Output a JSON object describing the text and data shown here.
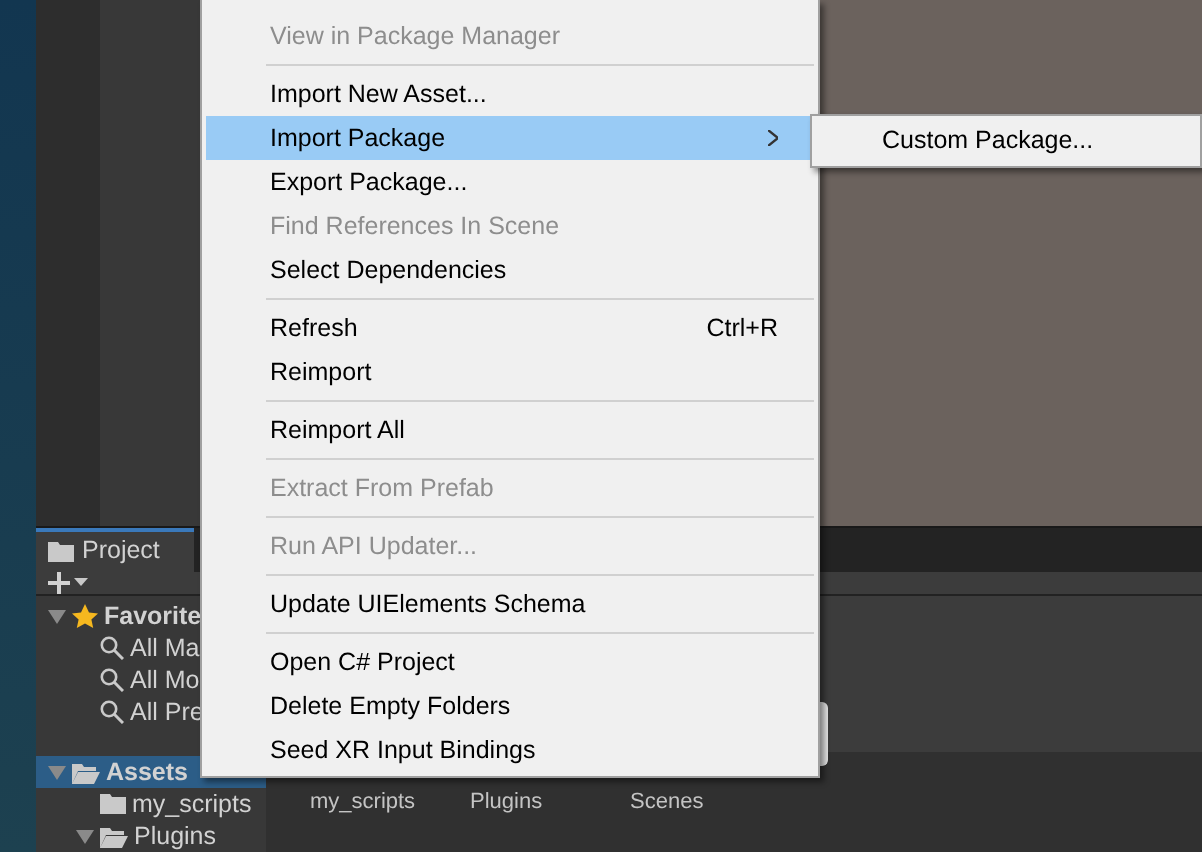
{
  "menu": {
    "items": [
      {
        "kind": "item",
        "label": "View in Package Manager",
        "disabled": true,
        "selected": false
      },
      {
        "kind": "separator"
      },
      {
        "kind": "item",
        "label": "Import New Asset...",
        "disabled": false,
        "selected": false
      },
      {
        "kind": "item",
        "label": "Import Package",
        "disabled": false,
        "selected": true,
        "submenu": true
      },
      {
        "kind": "item",
        "label": "Export Package...",
        "disabled": false,
        "selected": false
      },
      {
        "kind": "item",
        "label": "Find References In Scene",
        "disabled": true,
        "selected": false
      },
      {
        "kind": "item",
        "label": "Select Dependencies",
        "disabled": false,
        "selected": false
      },
      {
        "kind": "separator"
      },
      {
        "kind": "item",
        "label": "Refresh",
        "shortcut": "Ctrl+R",
        "disabled": false,
        "selected": false
      },
      {
        "kind": "item",
        "label": "Reimport",
        "disabled": false,
        "selected": false
      },
      {
        "kind": "separator"
      },
      {
        "kind": "item",
        "label": "Reimport All",
        "disabled": false,
        "selected": false
      },
      {
        "kind": "separator"
      },
      {
        "kind": "item",
        "label": "Extract From Prefab",
        "disabled": true,
        "selected": false
      },
      {
        "kind": "separator"
      },
      {
        "kind": "item",
        "label": "Run API Updater...",
        "disabled": true,
        "selected": false
      },
      {
        "kind": "separator"
      },
      {
        "kind": "item",
        "label": "Update UIElements Schema",
        "disabled": false,
        "selected": false
      },
      {
        "kind": "separator"
      },
      {
        "kind": "item",
        "label": "Open C# Project",
        "disabled": false,
        "selected": false
      },
      {
        "kind": "item",
        "label": "Delete Empty Folders",
        "disabled": false,
        "selected": false
      },
      {
        "kind": "item",
        "label": "Seed XR Input Bindings",
        "disabled": false,
        "selected": false
      }
    ]
  },
  "submenu": {
    "items": [
      {
        "label": "Custom Package...",
        "selected": false
      }
    ]
  },
  "project_panel": {
    "tab": "Project",
    "tree": [
      {
        "kind": "favorites",
        "label": "Favorite",
        "selected": false,
        "expanded": true,
        "children": [
          {
            "kind": "search",
            "label": "All Ma",
            "selected": false
          },
          {
            "kind": "search",
            "label": "All Mo",
            "selected": false
          },
          {
            "kind": "search",
            "label": "All Pre",
            "selected": false
          }
        ]
      },
      {
        "kind": "folder",
        "label": "Assets",
        "selected": true,
        "expanded": true,
        "children": [
          {
            "kind": "folder",
            "label": "my_scripts",
            "selected": false
          },
          {
            "kind": "folder",
            "label": "Plugins",
            "selected": false,
            "expanded": true
          }
        ]
      }
    ],
    "grid_items": [
      {
        "label": "my_scripts"
      },
      {
        "label": "Plugins"
      },
      {
        "label": "Scenes"
      }
    ]
  }
}
